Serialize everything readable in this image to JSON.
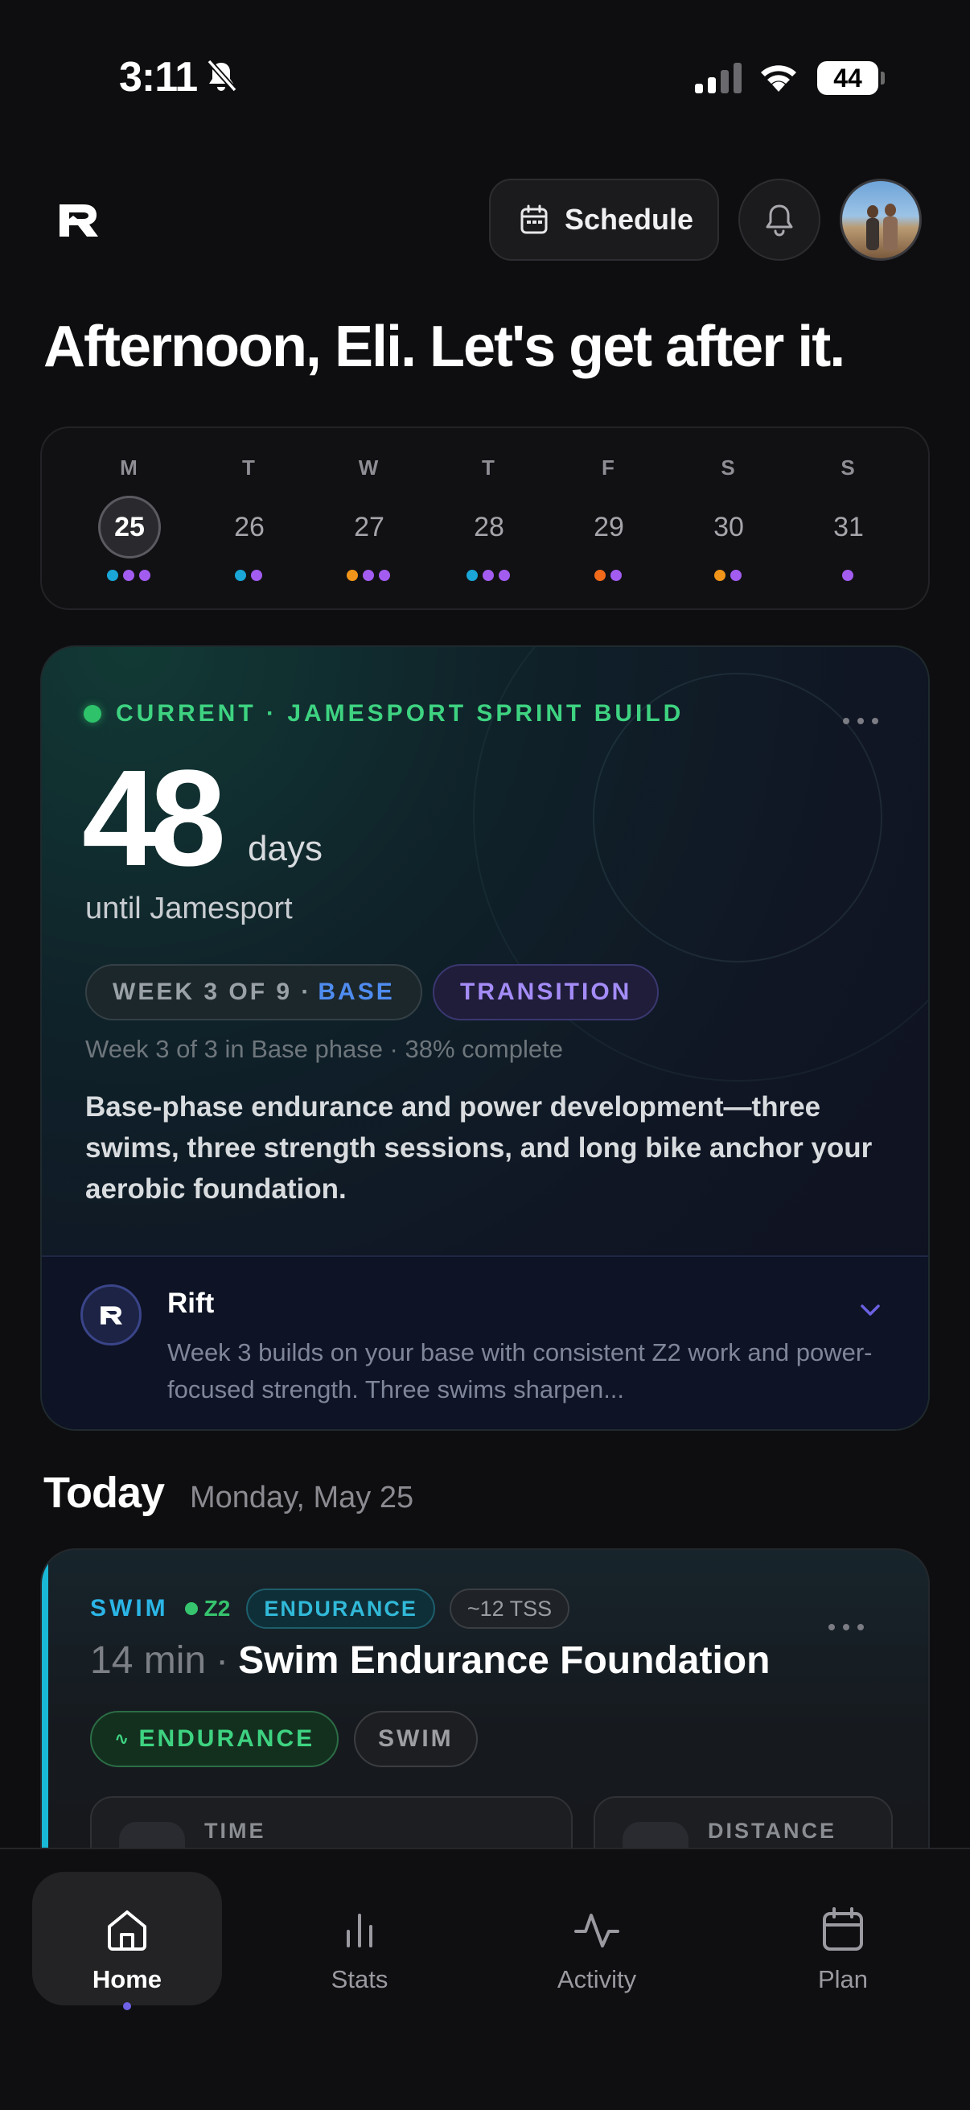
{
  "status_bar": {
    "time": "3:11",
    "battery": "44"
  },
  "header": {
    "schedule_label": "Schedule"
  },
  "greeting": "Afternoon, Eli. Let's get after it.",
  "week": [
    {
      "letter": "M",
      "num": "25",
      "selected": true,
      "dots": [
        "#1aa6d6",
        "#a35cf0",
        "#a35cf0"
      ]
    },
    {
      "letter": "T",
      "num": "26",
      "dots": [
        "#1aa6d6",
        "#a35cf0"
      ]
    },
    {
      "letter": "W",
      "num": "27",
      "dots": [
        "#f0951a",
        "#a35cf0",
        "#a35cf0"
      ]
    },
    {
      "letter": "T",
      "num": "28",
      "dots": [
        "#1aa6d6",
        "#a35cf0",
        "#a35cf0"
      ]
    },
    {
      "letter": "F",
      "num": "29",
      "dots": [
        "#f06a1a",
        "#a35cf0"
      ]
    },
    {
      "letter": "S",
      "num": "30",
      "dots": [
        "#f0951a",
        "#a35cf0"
      ]
    },
    {
      "letter": "S",
      "num": "31",
      "dots": [
        "#a35cf0"
      ]
    }
  ],
  "current": {
    "eyebrow": "CURRENT · JAMESPORT SPRINT BUILD",
    "days": "48",
    "days_unit": "days",
    "until": "until Jamesport",
    "week_pill": "WEEK 3 OF 9 ·",
    "phase_pill": "BASE",
    "transition_pill": "TRANSITION",
    "phase_note": "Week 3 of 3 in Base phase · 38% complete",
    "description": "Base-phase endurance and power development—three swims, three strength sessions, and long bike anchor your aerobic foundation.",
    "rift_title": "Rift",
    "rift_text": "Week 3 builds on your base with consistent Z2 work and power-focused strength. Three swims sharpen..."
  },
  "today": {
    "heading": "Today",
    "date": "Monday, May 25",
    "workout": {
      "sport": "SWIM",
      "zone": "Z2",
      "tag": "ENDURANCE",
      "tss": "~12 TSS",
      "duration": "14 min",
      "separator": "·",
      "name": "Swim Endurance Foundation",
      "pill_1_icon": "∿",
      "pill_1": "ENDURANCE",
      "pill_2": "SWIM",
      "stat_1_label": "TIME",
      "stat_2_label": "DISTANCE"
    }
  },
  "tabs": [
    {
      "label": "Home",
      "icon": "home-icon",
      "active": true
    },
    {
      "label": "Stats",
      "icon": "stats-icon"
    },
    {
      "label": "Activity",
      "icon": "activity-icon"
    },
    {
      "label": "Plan",
      "icon": "calendar-icon"
    }
  ],
  "colors": {
    "accent_green": "#3ed381",
    "accent_purple": "#a48cf7",
    "swim_blue": "#19b8d6"
  }
}
